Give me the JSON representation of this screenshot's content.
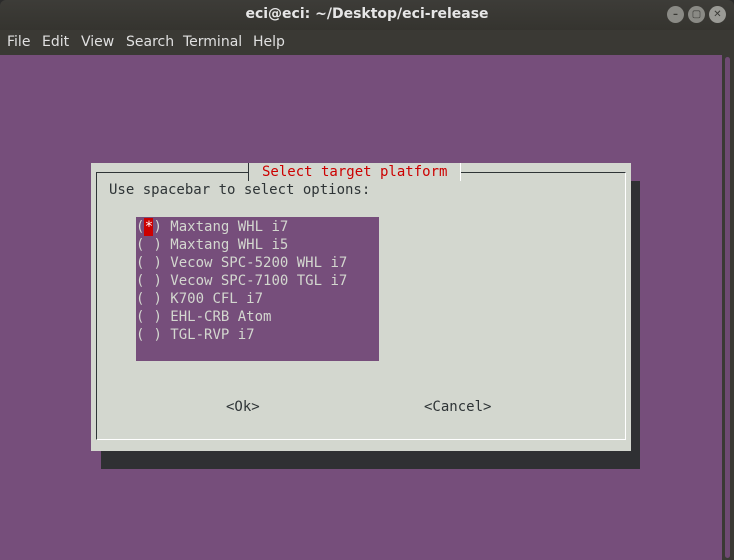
{
  "window": {
    "title": "eci@eci: ~/Desktop/eci-release"
  },
  "menu": [
    "File",
    "Edit",
    "View",
    "Search",
    "Terminal",
    "Help"
  ],
  "dialog": {
    "title": "Select target platform",
    "prompt": "Use spacebar to select options:",
    "options": [
      {
        "label": "Maxtang WHL i7",
        "selected": true
      },
      {
        "label": "Maxtang WHL i5",
        "selected": false
      },
      {
        "label": "Vecow SPC-5200 WHL i7",
        "selected": false
      },
      {
        "label": "Vecow SPC-7100 TGL i7",
        "selected": false
      },
      {
        "label": "K700 CFL i7",
        "selected": false
      },
      {
        "label": "EHL-CRB Atom",
        "selected": false
      },
      {
        "label": "TGL-RVP i7",
        "selected": false
      }
    ],
    "ok_label": "<Ok>",
    "cancel_label": "<Cancel>"
  },
  "colors": {
    "terminal_bg": "#764e7b",
    "dialog_bg": "#d3d7cf",
    "title_red": "#cc0000"
  }
}
